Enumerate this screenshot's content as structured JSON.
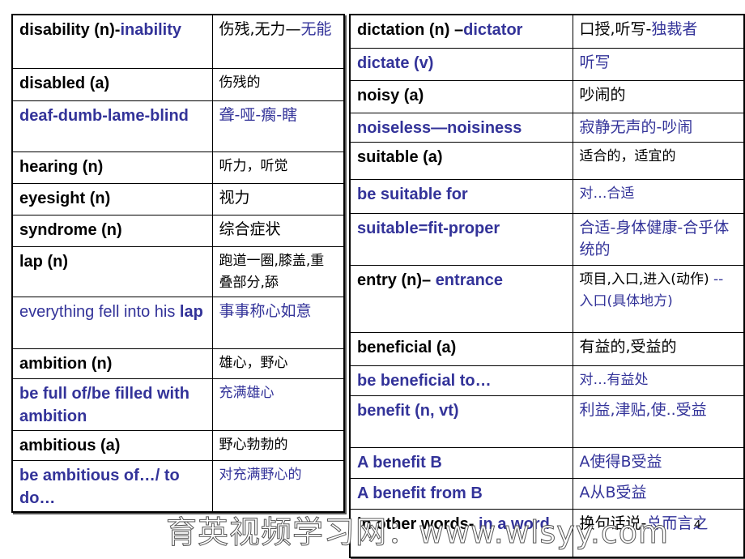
{
  "left_table": {
    "rows": [
      {
        "en": [
          {
            "text": "disability (n)-",
            "color": "black"
          },
          {
            "text": "inability",
            "color": "blue"
          }
        ],
        "zh": [
          {
            "text": "伤残,无力—",
            "color": "black"
          },
          {
            "text": "无能",
            "color": "blue"
          }
        ],
        "h": 66
      },
      {
        "en": [
          {
            "text": "disabled (a)",
            "color": "black"
          }
        ],
        "zh": [
          {
            "text": "伤残的",
            "color": "black"
          }
        ],
        "zh_small": true,
        "h": 40
      },
      {
        "en": [
          {
            "text": "deaf-dumb-lame-blind",
            "color": "blue"
          }
        ],
        "zh": [
          {
            "text": "聋-哑-瘸-瞎",
            "color": "blue"
          }
        ],
        "h": 63
      },
      {
        "en": [
          {
            "text": "hearing (n)",
            "color": "black"
          }
        ],
        "zh": [
          {
            "text": "听力，听觉",
            "color": "black"
          }
        ],
        "zh_small": true,
        "h": 39
      },
      {
        "en": [
          {
            "text": "eyesight (n)",
            "color": "black"
          }
        ],
        "zh": [
          {
            "text": "视力",
            "color": "black"
          }
        ],
        "h": 39
      },
      {
        "en": [
          {
            "text": "syndrome (n)",
            "color": "black"
          }
        ],
        "zh": [
          {
            "text": "综合症状",
            "color": "black"
          }
        ],
        "h": 39
      },
      {
        "en": [
          {
            "text": "lap (n)",
            "color": "black"
          }
        ],
        "zh": [
          {
            "text": "跑道一圈,膝盖,重叠部分,舔",
            "color": "black"
          }
        ],
        "zh_small": true,
        "h": 62
      },
      {
        "en": [
          {
            "text": "everything fell into his ",
            "color": "blue",
            "weight": "normal"
          },
          {
            "text": "lap",
            "color": "blue"
          }
        ],
        "zh": [
          {
            "text": "事事称心如意",
            "color": "blue"
          }
        ],
        "h": 64
      },
      {
        "en": [
          {
            "text": "ambition (n)",
            "color": "black"
          }
        ],
        "zh": [
          {
            "text": "雄心，野心",
            "color": "black"
          }
        ],
        "zh_small": true,
        "h": 37
      },
      {
        "en": [
          {
            "text": "be full of/be filled with ambition",
            "color": "blue"
          }
        ],
        "zh": [
          {
            "text": "充满雄心",
            "color": "blue"
          }
        ],
        "zh_small": true,
        "h": 64
      },
      {
        "en": [
          {
            "text": "ambitious (a)",
            "color": "black"
          }
        ],
        "zh": [
          {
            "text": "野心勃勃的",
            "color": "black"
          }
        ],
        "zh_small": true,
        "h": 37
      },
      {
        "en": [
          {
            "text": "be ambitious of…/ to do…",
            "color": "blue"
          }
        ],
        "zh": [
          {
            "text": "对充满野心的",
            "color": "blue"
          }
        ],
        "zh_small": true,
        "h": 64
      }
    ]
  },
  "right_table": {
    "rows": [
      {
        "en": [
          {
            "text": "dictation (n) –",
            "color": "black"
          },
          {
            "text": "dictator",
            "color": "blue"
          }
        ],
        "zh": [
          {
            "text": "口授,听写-",
            "color": "black"
          },
          {
            "text": "独裁者",
            "color": "blue"
          }
        ],
        "h": 41
      },
      {
        "en": [
          {
            "text": "dictate (v)",
            "color": "blue"
          }
        ],
        "zh": [
          {
            "text": "听写",
            "color": "blue"
          }
        ],
        "h": 40
      },
      {
        "en": [
          {
            "text": "noisy (a)",
            "color": "black"
          }
        ],
        "zh": [
          {
            "text": "吵闹的",
            "color": "black"
          }
        ],
        "h": 40
      },
      {
        "en": [
          {
            "text": "noiseless—noisiness",
            "color": "blue"
          }
        ],
        "zh": [
          {
            "text": "寂静无声的-吵闹",
            "color": "blue"
          }
        ],
        "h": 36
      },
      {
        "en": [
          {
            "text": "suitable (a)",
            "color": "black"
          }
        ],
        "zh": [
          {
            "text": "适合的，适宜的",
            "color": "black"
          }
        ],
        "zh_small": true,
        "h": 46
      },
      {
        "en": [
          {
            "text": "be suitable for",
            "color": "blue"
          }
        ],
        "zh": [
          {
            "text": "对…合适",
            "color": "blue"
          }
        ],
        "zh_small": true,
        "h": 42
      },
      {
        "en": [
          {
            "text": "suitable=fit-proper",
            "color": "blue"
          }
        ],
        "zh": [
          {
            "text": "合适-身体健康-合乎体统的",
            "color": "blue"
          }
        ],
        "h": 64
      },
      {
        "en": [
          {
            "text": "entry (n)– ",
            "color": "black"
          },
          {
            "text": "entrance",
            "color": "blue"
          }
        ],
        "zh": [
          {
            "text": "项目,入口,进入(动作) ",
            "color": "black"
          },
          {
            "text": "--入口(具体地方)",
            "color": "blue"
          }
        ],
        "zh_small": true,
        "h": 83
      },
      {
        "en": [
          {
            "text": "beneficial  (a)",
            "color": "black"
          }
        ],
        "zh": [
          {
            "text": "有益的,受益的",
            "color": "black"
          }
        ],
        "h": 41
      },
      {
        "en": [
          {
            "text": "be beneficial to…",
            "color": "blue"
          }
        ],
        "zh": [
          {
            "text": "对…有益处",
            "color": "blue"
          }
        ],
        "zh_small": true,
        "h": 37
      },
      {
        "en": [
          {
            "text": "benefit (n, vt)",
            "color": "blue"
          }
        ],
        "zh": [
          {
            "text": "利益,津贴,使..受益",
            "color": "blue"
          }
        ],
        "h": 64
      },
      {
        "en": [
          {
            "text": "A benefit B",
            "color": "blue"
          }
        ],
        "zh": [
          {
            "text": "A使得B受益",
            "color": "blue"
          }
        ],
        "h": 38
      },
      {
        "en": [
          {
            "text": "A benefit from B",
            "color": "blue"
          }
        ],
        "zh": [
          {
            "text": "A从B受益",
            "color": "blue"
          }
        ],
        "h": 38
      },
      {
        "en": [
          {
            "text": "in other words- ",
            "color": "black"
          },
          {
            "text": "in a word",
            "color": "blue"
          }
        ],
        "zh": [
          {
            "text": "换句话说-",
            "color": "black"
          },
          {
            "text": "总而言之",
            "color": "blue"
          }
        ],
        "h": 60
      }
    ]
  },
  "watermark": "育英视频学习网：www.wlsyy.com",
  "page_number": "4",
  "colors": {
    "black": "#000000",
    "blue": "#333399"
  }
}
